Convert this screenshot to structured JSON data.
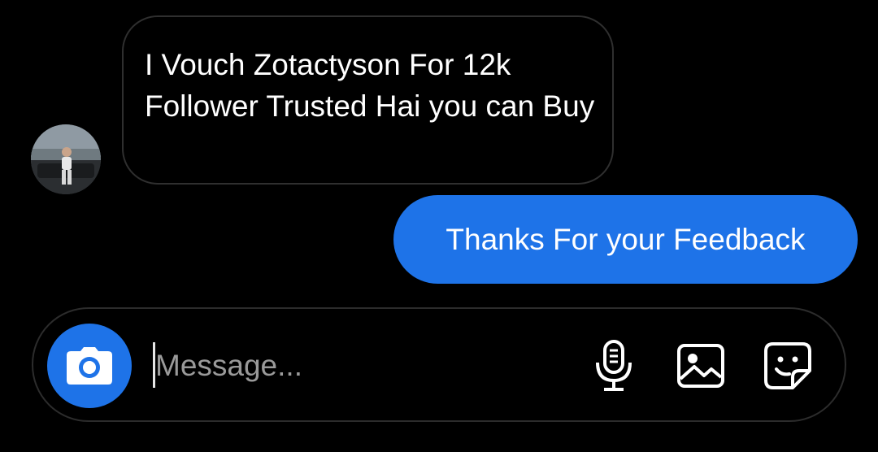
{
  "conversation": {
    "incoming": {
      "text": "I Vouch Zotactyson For 12k Follower Trusted Hai you can Buy"
    },
    "outgoing": {
      "text": "Thanks For your Feedback"
    }
  },
  "composer": {
    "placeholder": "Message...",
    "value": ""
  },
  "icons": {
    "camera": "camera-icon",
    "mic": "microphone-icon",
    "gallery": "image-gallery-icon",
    "sticker": "sticker-icon"
  },
  "colors": {
    "accent": "#1e73e8",
    "background": "#000000",
    "bubble_border": "#2f2f2f"
  }
}
